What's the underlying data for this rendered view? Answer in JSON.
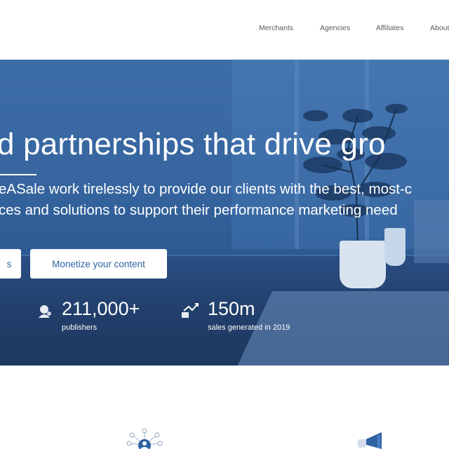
{
  "nav": {
    "items": [
      {
        "label": "Merchants"
      },
      {
        "label": "Agencies"
      },
      {
        "label": "Affiliates"
      },
      {
        "label": "About"
      }
    ]
  },
  "hero": {
    "headline": "d partnerships that drive gro",
    "subline_1": "eASale work tirelessly to provide our clients with the best, most-c",
    "subline_2": "ces and solutions to support their performance marketing need",
    "button_left_label": "s",
    "button_monetize_label": "Monetize your content",
    "stats": [
      {
        "value": "211,000+",
        "label": "publishers",
        "icon": "publisher-icon"
      },
      {
        "value": "150m",
        "label": "sales generated in 2019",
        "icon": "chart-growth-icon"
      }
    ]
  },
  "colors": {
    "hero_blue": "#3d6da9",
    "button_text": "#2f62a5",
    "nav_text": "#555b63"
  },
  "bottom": {
    "icons": [
      "network-icon",
      "megaphone-icon"
    ]
  }
}
